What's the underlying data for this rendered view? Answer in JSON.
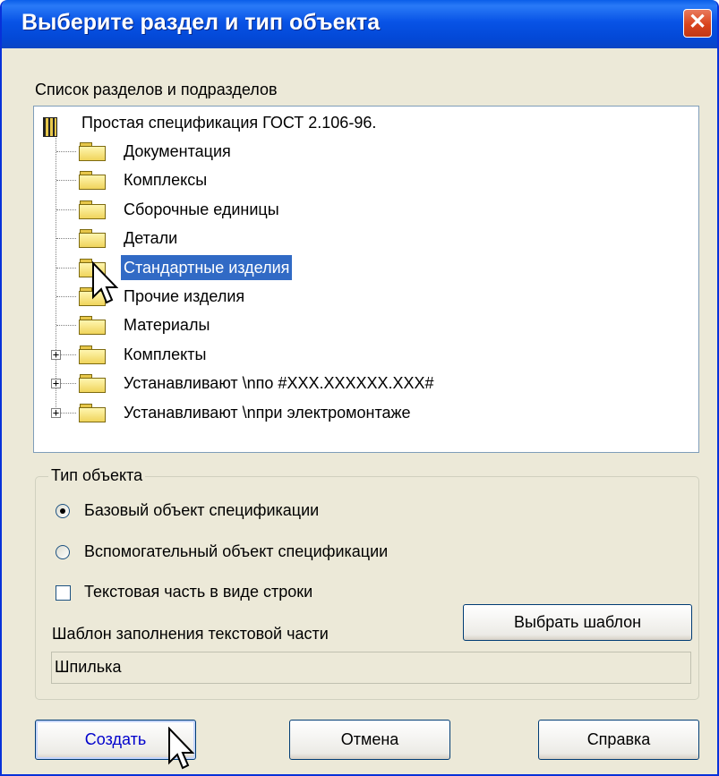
{
  "window": {
    "title": "Выберите раздел и тип объекта",
    "close_glyph": "✕"
  },
  "tree_label": "Список разделов и подразделов",
  "tree": {
    "root": "Простая спецификация ГОСТ 2.106-96.",
    "items": [
      {
        "label": "Документация",
        "expandable": false
      },
      {
        "label": "Комплексы",
        "expandable": false
      },
      {
        "label": "Сборочные единицы",
        "expandable": false
      },
      {
        "label": "Детали",
        "expandable": false
      },
      {
        "label": "Стандартные изделия",
        "expandable": false,
        "selected": true
      },
      {
        "label": "Прочие изделия",
        "expandable": false
      },
      {
        "label": "Материалы",
        "expandable": false
      },
      {
        "label": "Комплекты",
        "expandable": true
      },
      {
        "label": "Устанавливают \\nпо #XXX.XXXXXX.XXX#",
        "expandable": true
      },
      {
        "label": "Устанавливают \\nпри электромонтаже",
        "expandable": true
      }
    ],
    "expander_glyph": "+"
  },
  "object_type": {
    "title": "Тип объекта",
    "radio_base": "Базовый объект спецификации",
    "radio_aux": "Вспомогательный объект спецификации",
    "selected": "base",
    "checkbox_text_line": "Текстовая часть в виде строки",
    "checkbox_checked": false,
    "template_label": "Шаблон заполнения текстовой части",
    "choose_template_button": "Выбрать шаблон",
    "template_value": "Шпилька"
  },
  "buttons": {
    "create": "Создать",
    "cancel": "Отмена",
    "help": "Справка"
  },
  "colors": {
    "titlebar": "#0853e6",
    "selection": "#316ac5",
    "window_bg": "#ece9d8",
    "close": "#d9441c"
  }
}
